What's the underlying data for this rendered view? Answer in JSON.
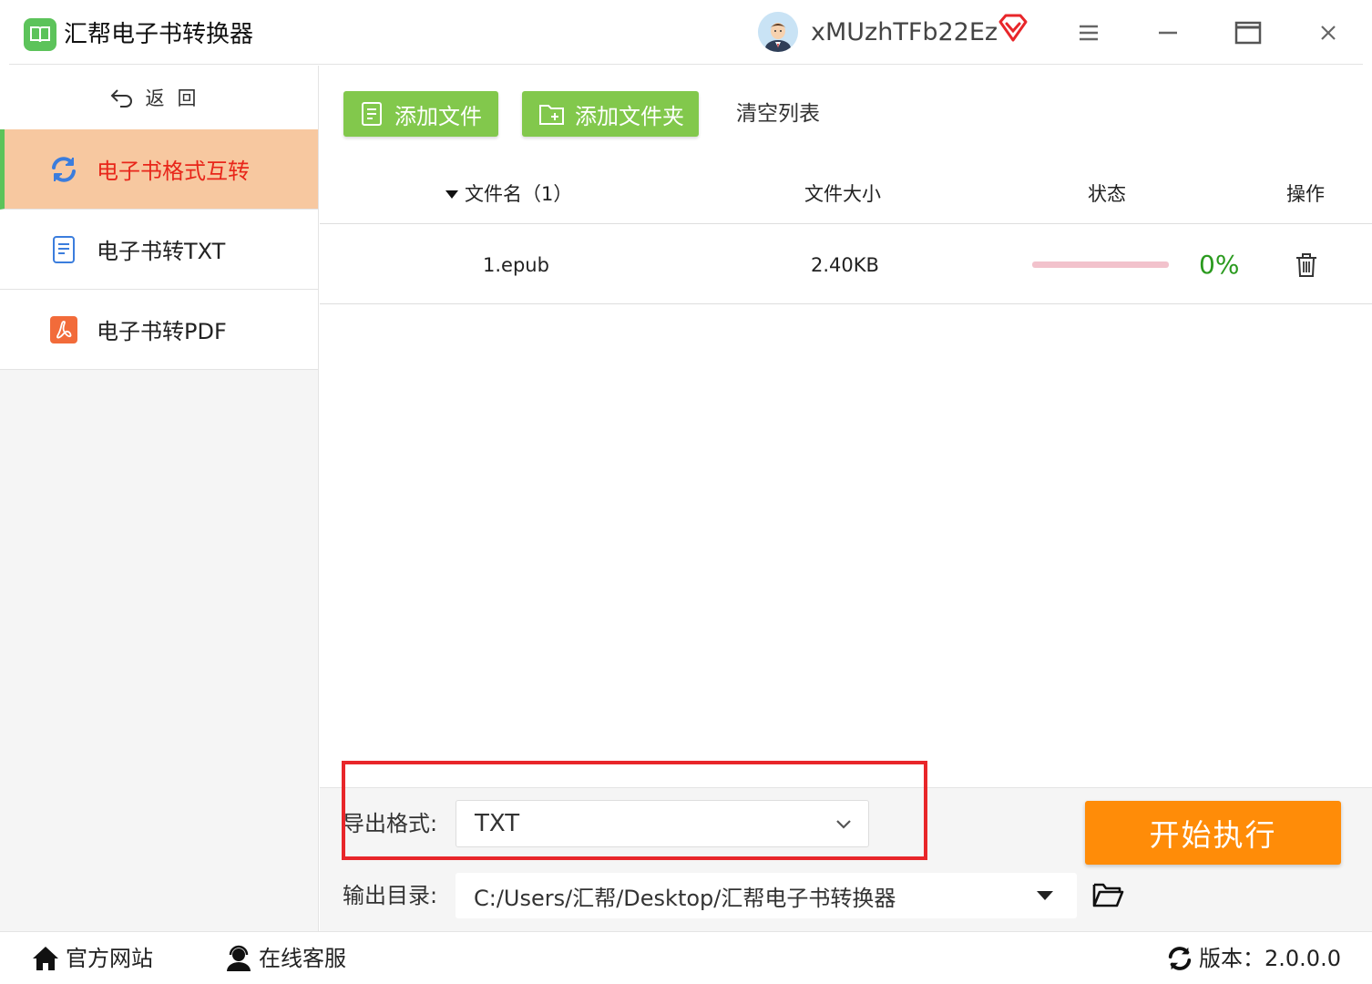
{
  "app": {
    "title": "汇帮电子书转换器",
    "username": "xMUzhTFb22Ez"
  },
  "sidebar": {
    "back_label": "返回",
    "items": [
      {
        "label": "电子书格式互转",
        "icon": "refresh-icon",
        "active": true
      },
      {
        "label": "电子书转TXT",
        "icon": "document-icon",
        "active": false
      },
      {
        "label": "电子书转PDF",
        "icon": "pdf-icon",
        "active": false
      }
    ]
  },
  "toolbar": {
    "add_file": "添加文件",
    "add_folder": "添加文件夹",
    "clear_list": "清空列表"
  },
  "table": {
    "headers": {
      "name": "文件名（1）",
      "size": "文件大小",
      "status": "状态",
      "action": "操作"
    },
    "rows": [
      {
        "name": "1.epub",
        "size": "2.40KB",
        "progress": 0,
        "progress_text": "0%"
      }
    ]
  },
  "output": {
    "format_label": "导出格式:",
    "format_value": "TXT",
    "dir_label": "输出目录:",
    "dir_value": "C:/Users/汇帮/Desktop/汇帮电子书转换器",
    "start_label": "开始执行"
  },
  "footer": {
    "website": "官方网站",
    "support": "在线客服",
    "version": "版本：2.0.0.0"
  },
  "colors": {
    "green": "#82c84c",
    "active_bg": "#f7c8a0",
    "active_text": "#e8261a",
    "orange": "#ff8c08",
    "highlight": "#e8262a",
    "progress_track": "#f2c2cc",
    "percent": "#2a9a1e"
  }
}
